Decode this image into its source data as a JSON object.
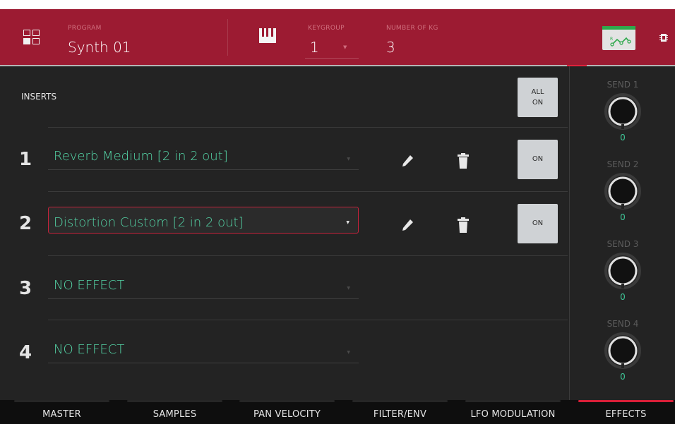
{
  "header": {
    "program_caption": "PROGRAM",
    "program_name": "Synth 01",
    "keygroup_caption": "KEYGROUP",
    "keygroup_value": "1",
    "number_of_kg_caption": "NUMBER OF KG",
    "number_of_kg_value": "3",
    "route_button_label": "R"
  },
  "inserts": {
    "title": "INSERTS",
    "all_on_line1": "ALL",
    "all_on_line2": "ON",
    "slots": [
      {
        "number": "1",
        "effect": "Reverb Medium [2 in 2 out]",
        "on_label": "ON",
        "has_controls": true,
        "active": false
      },
      {
        "number": "2",
        "effect": "Distortion Custom [2 in 2 out]",
        "on_label": "ON",
        "has_controls": true,
        "active": true
      },
      {
        "number": "3",
        "effect": "NO EFFECT",
        "has_controls": false,
        "active": false
      },
      {
        "number": "4",
        "effect": "NO EFFECT",
        "has_controls": false,
        "active": false
      }
    ]
  },
  "sends": [
    {
      "label": "SEND 1",
      "value": "0"
    },
    {
      "label": "SEND 2",
      "value": "0"
    },
    {
      "label": "SEND 3",
      "value": "0"
    },
    {
      "label": "SEND 4",
      "value": "0"
    }
  ],
  "tabs": [
    {
      "label": "MASTER",
      "selected": false
    },
    {
      "label": "SAMPLES",
      "selected": false
    },
    {
      "label": "PAN VELOCITY",
      "selected": false
    },
    {
      "label": "FILTER/ENV",
      "selected": false
    },
    {
      "label": "LFO MODULATION",
      "selected": false
    },
    {
      "label": "EFFECTS",
      "selected": true
    }
  ],
  "colors": {
    "header_bg": "#9c1b32",
    "accent_red": "#d81f38",
    "effect_text": "#54d4a6",
    "send_value": "#3fc999",
    "route_green": "#2ea94c"
  }
}
